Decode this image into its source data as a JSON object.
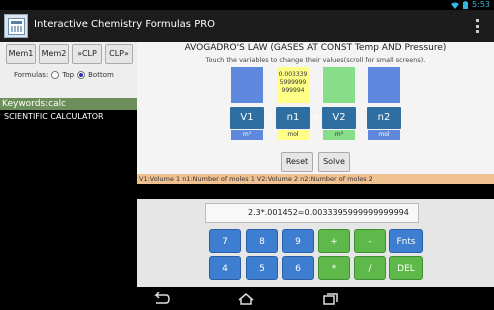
{
  "status": {
    "time": "5:53"
  },
  "appbar": {
    "title": "Interactive Chemistry Formulas PRO"
  },
  "memory": {
    "mem1": "Mem1",
    "mem2": "Mem2",
    "to_clp": "»CLP",
    "from_clp": "CLP»"
  },
  "formulas": {
    "label": "Formulas:",
    "top_label": "Top",
    "bottom_label": "Bottom",
    "selected": "Bottom"
  },
  "keywords": {
    "label": "Keywords:calc"
  },
  "sidebar": {
    "item": "SCIENTIFIC CALCULATOR"
  },
  "law": {
    "title": "AVOGADRO'S LAW (GASES AT CONST Temp AND Pressure)",
    "subtitle": "Touch the variables to change their values(scroll for small screens).",
    "n1_value": [
      "0.003339",
      "5999999",
      "999994"
    ],
    "vars": {
      "v1": "V1",
      "n1": "n1",
      "v2": "V2",
      "n2": "n2"
    },
    "ops": {
      "div1": "/",
      "eq": "=",
      "div2": "/"
    },
    "units": {
      "v1": "m³",
      "n1": "mol",
      "v2": "m³",
      "n2": "mol"
    },
    "reset": "Reset",
    "solve": "Solve",
    "legend": "V1:Volume 1  n1:Number of moles 1  V2:Volume 2  n2:Number of moles 2"
  },
  "calculator": {
    "display": "2.3*.001452=0.0033395999999999994",
    "keys": [
      "7",
      "8",
      "9",
      "+",
      "-",
      "Fnts",
      "4",
      "5",
      "6",
      "*",
      "/",
      "DEL"
    ]
  },
  "colors": {
    "blue": "#5e87de",
    "yellow": "#ffff88",
    "green": "#88dd88",
    "legend": "#f0c090",
    "keywords": "#6d8f5a",
    "key_blue": "#3e7ed0",
    "key_green": "#5fb84a"
  },
  "icons": {
    "back": "back-icon",
    "home": "home-icon",
    "recents": "recents-icon",
    "wifi": "wifi-icon",
    "battery": "battery-icon",
    "overflow": "overflow-menu-icon"
  }
}
